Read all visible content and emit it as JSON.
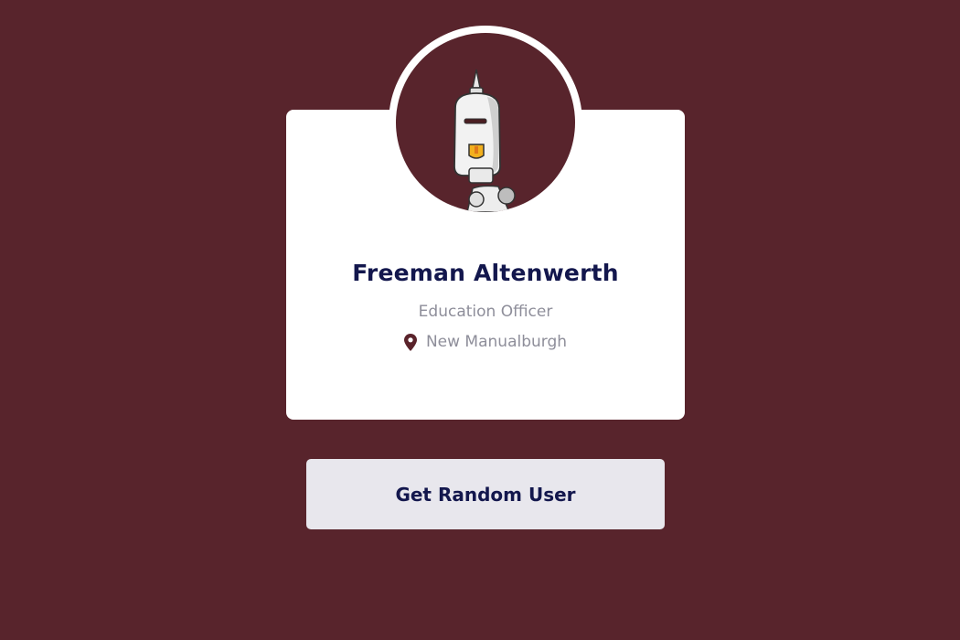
{
  "colors": {
    "background": "#58242c",
    "card": "#ffffff",
    "name": "#13174d",
    "muted": "#8e8e9a",
    "button_bg": "#e8e7ed"
  },
  "profile": {
    "avatar_icon": "robot-avatar",
    "name": "Freeman Altenwerth",
    "role": "Education Officer",
    "location_icon": "map-pin-icon",
    "location": "New Manualburgh"
  },
  "actions": {
    "random_user_label": "Get Random User"
  }
}
